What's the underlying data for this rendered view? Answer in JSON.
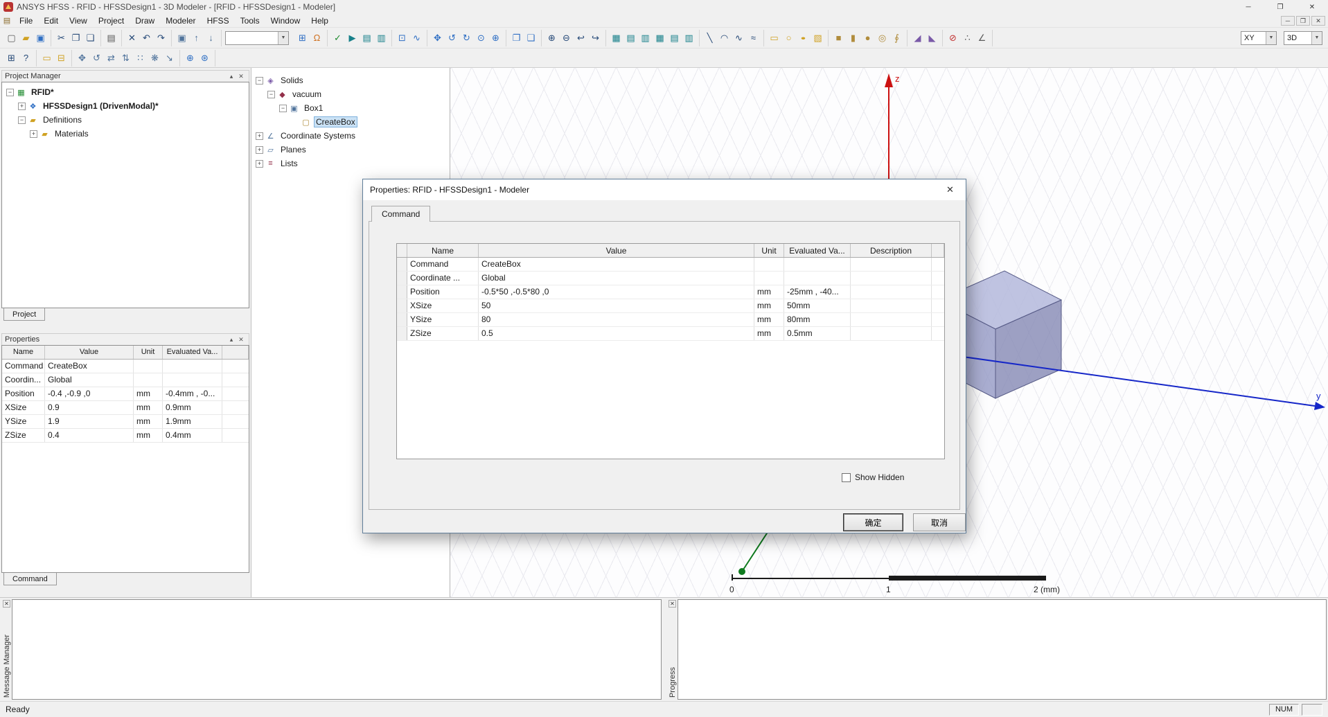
{
  "window": {
    "title": "ANSYS HFSS - RFID - HFSSDesign1 - 3D Modeler - [RFID - HFSSDesign1 - Modeler]",
    "minimize": "─",
    "maximize": "❐",
    "close": "✕"
  },
  "glyphs": {
    "dropdown_arrow": "▼",
    "collapse": "▴",
    "close": "✕"
  },
  "menu": {
    "mdi_icon": "▤",
    "items": [
      "File",
      "Edit",
      "View",
      "Project",
      "Draw",
      "Modeler",
      "HFSS",
      "Tools",
      "Window",
      "Help"
    ]
  },
  "toolbar1": {
    "file": [
      {
        "n": "new-file-icon",
        "g": "▢",
        "c": "dim"
      },
      {
        "n": "open-folder-icon",
        "g": "▰",
        "c": "yellow"
      },
      {
        "n": "save-icon",
        "g": "▣",
        "c": "blue"
      }
    ],
    "clipboard": [
      {
        "n": "cut-icon",
        "g": "✂",
        "c": "navy"
      },
      {
        "n": "copy-icon",
        "g": "❐",
        "c": "navy"
      },
      {
        "n": "paste-icon",
        "g": "❏",
        "c": "navy"
      }
    ],
    "print": [
      {
        "n": "print-icon",
        "g": "▤",
        "c": "dim"
      }
    ],
    "edit": [
      {
        "n": "delete-icon",
        "g": "✕",
        "c": "navy"
      },
      {
        "n": "undo-icon",
        "g": "↶",
        "c": "navy"
      },
      {
        "n": "redo-icon",
        "g": "↷",
        "c": "navy"
      }
    ],
    "select": [
      {
        "n": "select-mode-icon",
        "g": "▣",
        "c": "steel"
      },
      {
        "n": "select-up-icon",
        "g": "↑",
        "c": "steel"
      },
      {
        "n": "select-down-icon",
        "g": "↓",
        "c": "steel"
      }
    ],
    "snap_combo": {
      "value": ""
    },
    "snap": [
      {
        "n": "grid-settings-icon",
        "g": "⊞",
        "c": "blue"
      },
      {
        "n": "boundary-display-icon",
        "g": "Ω",
        "c": "orange"
      }
    ],
    "simulate": [
      {
        "n": "validate-icon",
        "g": "✓",
        "c": "green"
      },
      {
        "n": "analyze-all-icon",
        "g": "▶",
        "c": "teal"
      },
      {
        "n": "edit-sources-icon",
        "g": "▤",
        "c": "teal"
      },
      {
        "n": "results-icon",
        "g": "▥",
        "c": "teal"
      }
    ],
    "view_tools": [
      {
        "n": "zoom-window-icon",
        "g": "⊡",
        "c": "blue"
      },
      {
        "n": "measure-icon",
        "g": "∿",
        "c": "blue"
      }
    ],
    "orbit": [
      {
        "n": "pan-icon",
        "g": "✥",
        "c": "blue"
      },
      {
        "n": "rotate-model-icon",
        "g": "↺",
        "c": "blue"
      },
      {
        "n": "rotate-view-icon",
        "g": "↻",
        "c": "blue"
      },
      {
        "n": "rotate-screen-icon",
        "g": "⊙",
        "c": "blue"
      },
      {
        "n": "dynamic-zoom-icon",
        "g": "⊕",
        "c": "blue"
      }
    ],
    "fit": [
      {
        "n": "fit-all-icon",
        "g": "❐",
        "c": "blue"
      },
      {
        "n": "fit-selection-icon",
        "g": "❑",
        "c": "blue"
      }
    ],
    "zoom": [
      {
        "n": "zoom-in-icon",
        "g": "⊕",
        "c": "navy"
      },
      {
        "n": "zoom-out-icon",
        "g": "⊖",
        "c": "navy"
      },
      {
        "n": "previous-view-icon",
        "g": "↩",
        "c": "navy"
      },
      {
        "n": "next-view-icon",
        "g": "↪",
        "c": "navy"
      }
    ],
    "lists": [
      {
        "n": "object-list-icon",
        "g": "▦",
        "c": "teal"
      },
      {
        "n": "boundaries-list-icon",
        "g": "▤",
        "c": "teal"
      },
      {
        "n": "excitations-list-icon",
        "g": "▥",
        "c": "teal"
      },
      {
        "n": "mesh-list-icon",
        "g": "▦",
        "c": "teal"
      },
      {
        "n": "setup-list-icon",
        "g": "▤",
        "c": "teal"
      },
      {
        "n": "optimetrics-list-icon",
        "g": "▥",
        "c": "teal"
      }
    ],
    "draw_curves": [
      {
        "n": "draw-line-icon",
        "g": "╲",
        "c": "navy"
      },
      {
        "n": "draw-arc-icon",
        "g": "◠",
        "c": "navy"
      },
      {
        "n": "draw-spline-icon",
        "g": "∿",
        "c": "navy"
      },
      {
        "n": "draw-polyline-icon",
        "g": "≈",
        "c": "navy"
      }
    ],
    "draw_2d": [
      {
        "n": "draw-rectangle-icon",
        "g": "▭",
        "c": "yellow"
      },
      {
        "n": "draw-circle-icon",
        "g": "○",
        "c": "yellow"
      },
      {
        "n": "draw-ellipse-icon",
        "g": "●",
        "c": "yellow"
      },
      {
        "n": "draw-region-icon",
        "g": "▧",
        "c": "yellow"
      }
    ],
    "draw_3d": [
      {
        "n": "draw-box-icon",
        "g": "■",
        "c": "tan"
      },
      {
        "n": "draw-cylinder-icon",
        "g": "▮",
        "c": "tan"
      },
      {
        "n": "draw-sphere-icon",
        "g": "●",
        "c": "tan"
      },
      {
        "n": "draw-torus-icon",
        "g": "◎",
        "c": "tan"
      },
      {
        "n": "draw-helix-icon",
        "g": "∮",
        "c": "tan"
      }
    ],
    "sweep": [
      {
        "n": "sweep-icon",
        "g": "◢",
        "c": "purple"
      },
      {
        "n": "thicken-icon",
        "g": "◣",
        "c": "purple"
      }
    ],
    "misc": [
      {
        "n": "no-model-icon",
        "g": "⊘",
        "c": "red"
      },
      {
        "n": "snap-point-icon",
        "g": "∴",
        "c": "dim"
      },
      {
        "n": "measure-angle-icon",
        "g": "∠",
        "c": "dim"
      }
    ],
    "plane_combo": {
      "value": "XY"
    },
    "mode_combo": {
      "value": "3D"
    }
  },
  "toolbar2": {
    "insert": [
      {
        "n": "insert-document-icon",
        "g": "⊞",
        "c": "navy"
      },
      {
        "n": "context-help-icon",
        "g": "?",
        "c": "navy"
      }
    ],
    "pages": [
      {
        "n": "ruler-icon",
        "g": "▭",
        "c": "yellow"
      },
      {
        "n": "snap-mode-icon",
        "g": "⊟",
        "c": "yellow"
      }
    ],
    "transform": [
      {
        "n": "move-icon",
        "g": "✥",
        "c": "steel"
      },
      {
        "n": "rotate-icon",
        "g": "↺",
        "c": "steel"
      },
      {
        "n": "mirror-icon",
        "g": "⇄",
        "c": "steel"
      },
      {
        "n": "offset-icon",
        "g": "⇅",
        "c": "steel"
      },
      {
        "n": "duplicate-line-icon",
        "g": "∷",
        "c": "steel"
      },
      {
        "n": "duplicate-axis-icon",
        "g": "❋",
        "c": "steel"
      },
      {
        "n": "scale-icon",
        "g": "↘",
        "c": "steel"
      }
    ],
    "cs": [
      {
        "n": "working-cs-icon",
        "g": "⊕",
        "c": "blue"
      },
      {
        "n": "global-cs-icon",
        "g": "⊛",
        "c": "blue"
      }
    ]
  },
  "project_manager": {
    "title": "Project Manager",
    "tab": "Project",
    "tree": [
      {
        "label": "RFID*",
        "level": 0,
        "expand": "−",
        "bold": true,
        "icon": {
          "n": "project-icon",
          "g": "▦",
          "c": "green"
        }
      },
      {
        "label": "HFSSDesign1 (DrivenModal)*",
        "level": 1,
        "expand": "+",
        "bold": true,
        "icon": {
          "n": "design-icon",
          "g": "❖",
          "c": "blue"
        }
      },
      {
        "label": "Definitions",
        "level": 1,
        "expand": "−",
        "icon": {
          "n": "folder-icon",
          "g": "▰",
          "c": "yellow"
        }
      },
      {
        "label": "Materials",
        "level": 2,
        "expand": "+",
        "icon": {
          "n": "folder-icon",
          "g": "▰",
          "c": "yellow"
        }
      }
    ]
  },
  "properties_panel": {
    "title": "Properties",
    "tab": "Command",
    "columns": [
      "Name",
      "Value",
      "Unit",
      "Evaluated Va..."
    ],
    "rows": [
      [
        "Command",
        "CreateBox",
        "",
        ""
      ],
      [
        "Coordin...",
        "Global",
        "",
        ""
      ],
      [
        "Position",
        "-0.4 ,-0.9 ,0",
        "mm",
        "-0.4mm , -0..."
      ],
      [
        "XSize",
        "0.9",
        "mm",
        "0.9mm"
      ],
      [
        "YSize",
        "1.9",
        "mm",
        "1.9mm"
      ],
      [
        "ZSize",
        "0.4",
        "mm",
        "0.4mm"
      ]
    ]
  },
  "model_tree": {
    "items": [
      {
        "label": "Solids",
        "level": 0,
        "expand": "−",
        "icon": {
          "n": "solids-icon",
          "g": "◈",
          "c": "purple"
        }
      },
      {
        "label": "vacuum",
        "level": 1,
        "expand": "−",
        "icon": {
          "n": "material-icon",
          "g": "◆",
          "c": "maroon"
        }
      },
      {
        "label": "Box1",
        "level": 2,
        "expand": "−",
        "icon": {
          "n": "box-object-icon",
          "g": "▣",
          "c": "steel"
        }
      },
      {
        "label": "CreateBox",
        "level": 3,
        "expand": "",
        "selected": true,
        "icon": {
          "n": "command-icon",
          "g": "▢",
          "c": "tan"
        }
      },
      {
        "label": "Coordinate Systems",
        "level": 0,
        "expand": "+",
        "icon": {
          "n": "coordinate-systems-icon",
          "g": "∠",
          "c": "steel"
        }
      },
      {
        "label": "Planes",
        "level": 0,
        "expand": "+",
        "icon": {
          "n": "planes-icon",
          "g": "▱",
          "c": "steel"
        }
      },
      {
        "label": "Lists",
        "level": 0,
        "expand": "+",
        "icon": {
          "n": "lists-icon",
          "g": "≡",
          "c": "maroon"
        }
      }
    ]
  },
  "dialog": {
    "title": "Properties: RFID - HFSSDesign1 - Modeler",
    "tab": "Command",
    "columns": [
      "Name",
      "Value",
      "Unit",
      "Evaluated Va...",
      "Description"
    ],
    "rows": [
      [
        "Command",
        "CreateBox",
        "",
        "",
        ""
      ],
      [
        "Coordinate ...",
        "Global",
        "",
        "",
        ""
      ],
      [
        "Position",
        "-0.5*50 ,-0.5*80 ,0",
        "mm",
        "-25mm , -40...",
        ""
      ],
      [
        "XSize",
        "50",
        "mm",
        "50mm",
        ""
      ],
      [
        "YSize",
        "80",
        "mm",
        "80mm",
        ""
      ],
      [
        "ZSize",
        "0.5",
        "mm",
        "0.5mm",
        ""
      ]
    ],
    "show_hidden": "Show Hidden",
    "ok": "确定",
    "cancel": "取消"
  },
  "viewport": {
    "z_label": "z",
    "y_label": "y",
    "ruler": {
      "t0": "0",
      "t1": "1",
      "t2": "2 (mm)"
    },
    "colors": {
      "z_axis": "#cc1111",
      "y_axis": "#1526c8",
      "x_axis": "#0e7a1e",
      "box_top": "#b4b8dc",
      "box_left": "#9498c4",
      "box_right": "#8488b4"
    }
  },
  "docks": {
    "message_manager_label": "Message Manager",
    "progress_label": "Progress"
  },
  "status_bar": {
    "ready": "Ready",
    "num": "NUM"
  }
}
